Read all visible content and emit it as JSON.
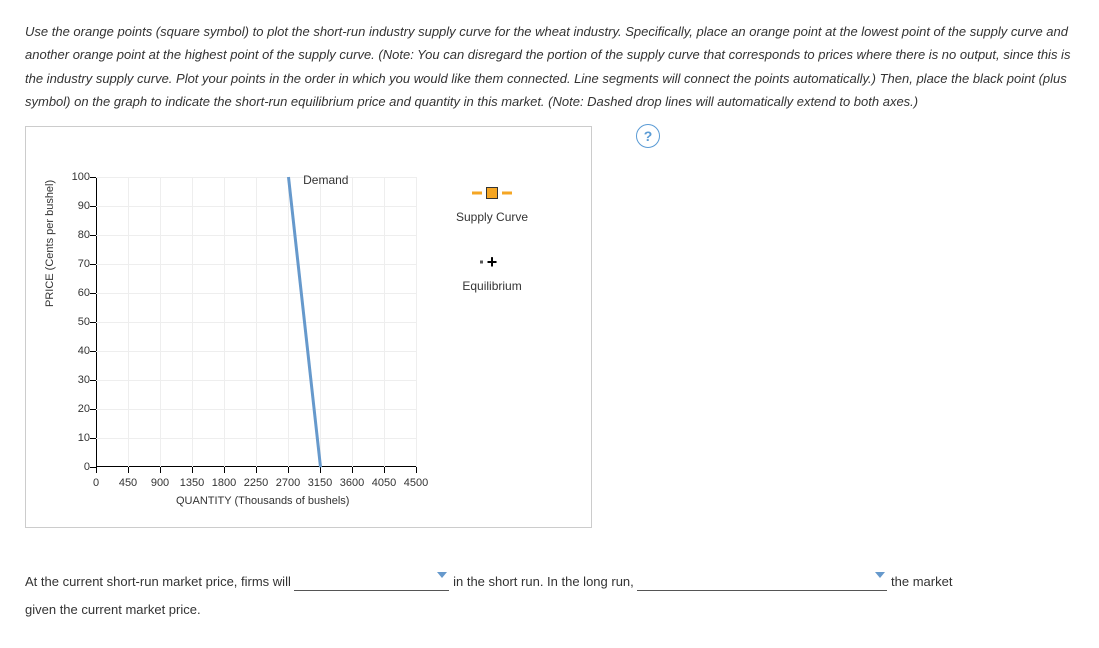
{
  "instructions": "Use the orange points (square symbol) to plot the short-run industry supply curve for the wheat industry. Specifically, place an orange point at the lowest point of the supply curve and another orange point at the highest point of the supply curve. (Note: You can disregard the portion of the supply curve that corresponds to prices where there is no output, since this is the industry supply curve. Plot your points in the order in which you would like them connected. Line segments will connect the points automatically.) Then, place the black point (plus symbol) on the graph to indicate the short-run equilibrium price and quantity in this market. (Note: Dashed drop lines will automatically extend to both axes.)",
  "help_symbol": "?",
  "chart_data": {
    "type": "line",
    "title": "",
    "xlabel": "QUANTITY (Thousands of bushels)",
    "ylabel": "PRICE (Cents per bushel)",
    "x_ticks": [
      0,
      450,
      900,
      1350,
      1800,
      2250,
      2700,
      3150,
      3600,
      4050,
      4500
    ],
    "y_ticks": [
      0,
      10,
      20,
      30,
      40,
      50,
      60,
      70,
      80,
      90,
      100
    ],
    "xlim": [
      0,
      4500
    ],
    "ylim": [
      0,
      100
    ],
    "series": [
      {
        "name": "Demand",
        "color": "#6699cc",
        "x": [
          2700,
          3150
        ],
        "y": [
          100,
          0
        ]
      }
    ],
    "annotations": [
      {
        "text": "Demand",
        "x": 2800,
        "y": 100
      }
    ]
  },
  "legend": {
    "supply_label": "Supply Curve",
    "equilibrium_label": "Equilibrium"
  },
  "fill_in": {
    "part1": "At the current short-run market price, firms will",
    "part2": "in the short run. In the long run,",
    "part3": "the market",
    "part4": "given the current market price."
  }
}
